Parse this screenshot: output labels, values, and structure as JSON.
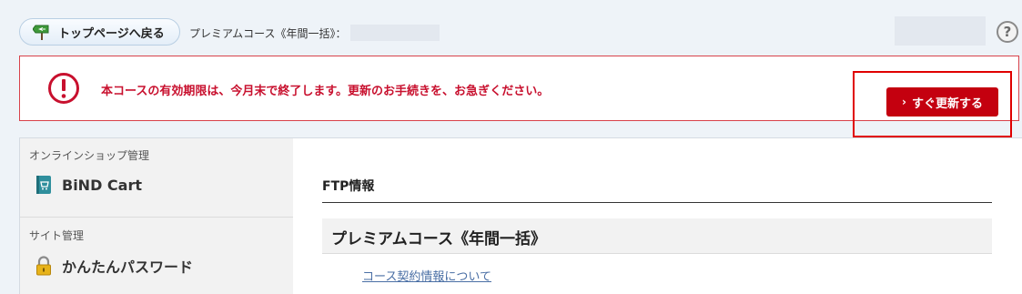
{
  "header": {
    "back_button_label": "トップページへ戻る",
    "course_label": "プレミアムコース《年間一括》：",
    "help_glyph": "?"
  },
  "alert": {
    "message": "本コースの有効期限は、今月末で終了します。更新のお手続きを、お急ぎください。",
    "renew_chevron": "›",
    "renew_button_label": "すぐ更新する",
    "accent_color": "#c4000f"
  },
  "sidebar": {
    "sections": [
      {
        "heading": "オンラインショップ管理",
        "item_label": "BiND Cart",
        "icon": "cart-book-icon"
      },
      {
        "heading": "サイト管理",
        "item_label": "かんたんパスワード",
        "icon": "lock-icon"
      }
    ]
  },
  "content": {
    "section_title": "FTP情報",
    "course_heading": "プレミアムコース《年間一括》",
    "contract_link": "コース契約情報について"
  }
}
